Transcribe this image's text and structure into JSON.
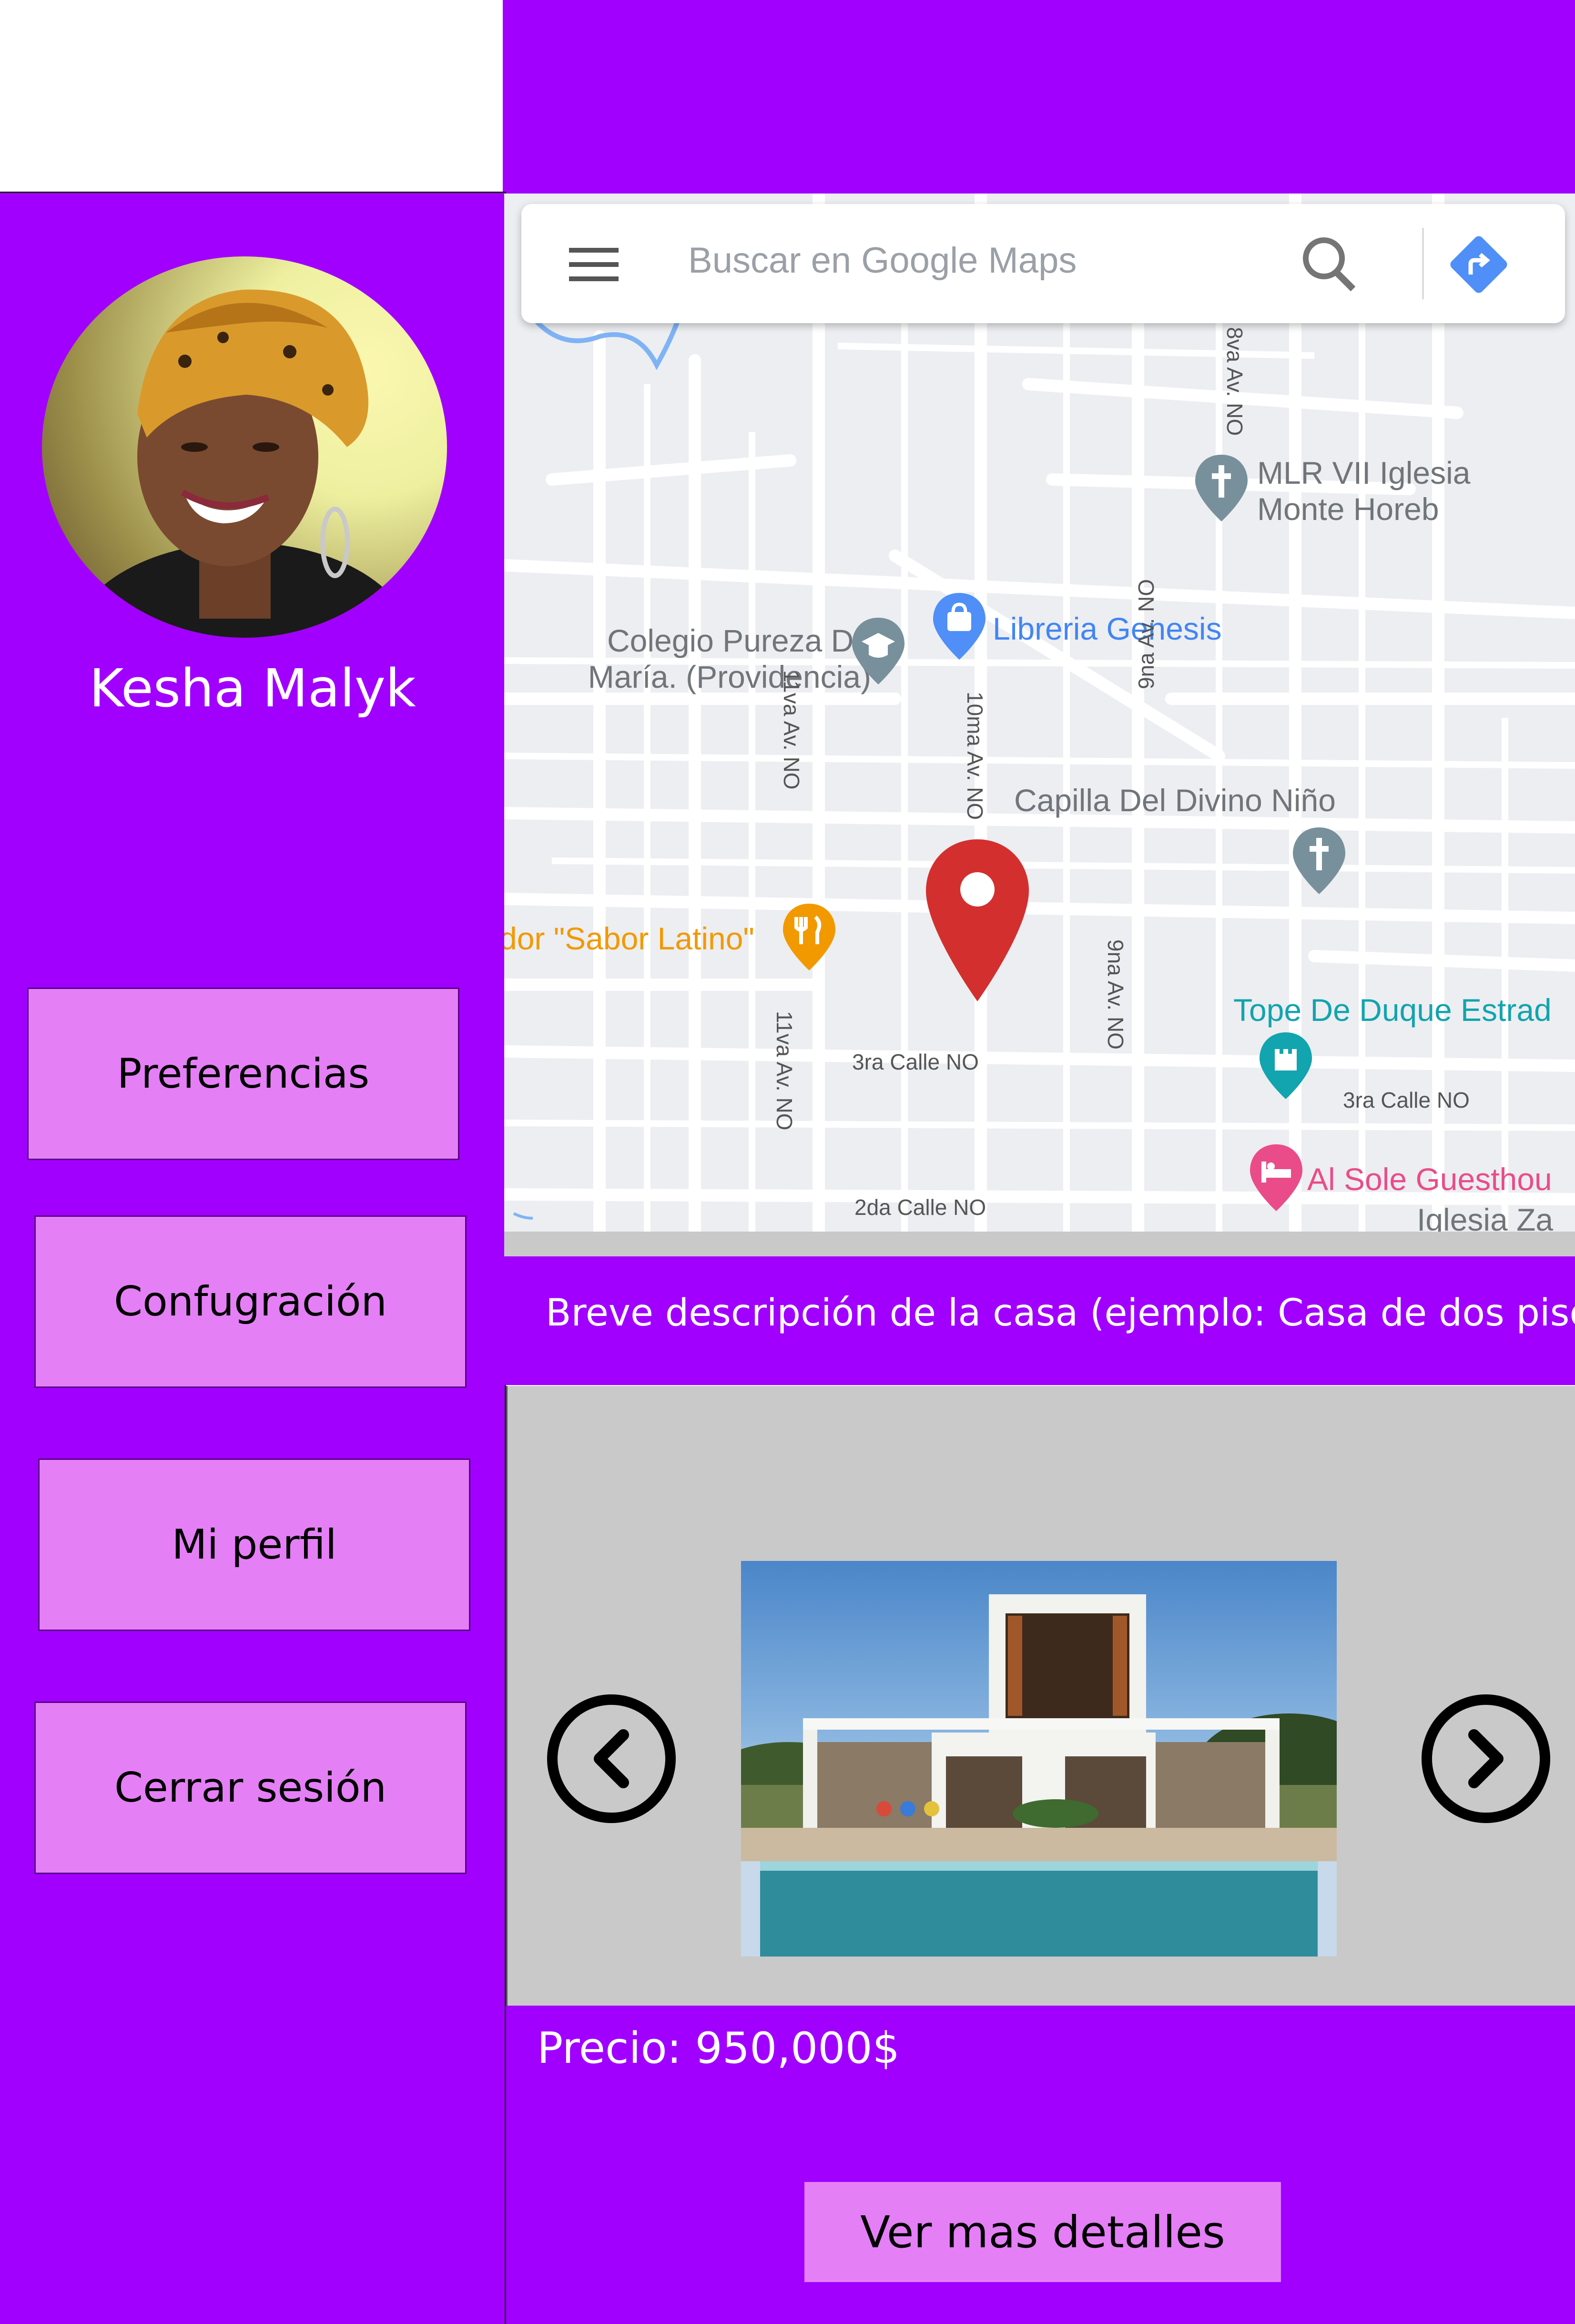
{
  "user": {
    "name": "Kesha Malyk"
  },
  "menu": {
    "items": [
      {
        "label": "Preferencias"
      },
      {
        "label": "Confugración"
      },
      {
        "label": "Mi perfil"
      },
      {
        "label": "Cerrar sesión"
      }
    ]
  },
  "map": {
    "search_placeholder": "Buscar en Google Maps",
    "places": {
      "iglesia_line1": "MLR VII Iglesia",
      "iglesia_line2": "Monte Horeb",
      "colegio_line1": "Colegio Pureza De",
      "colegio_line2": "María. (Providencia)",
      "libreria": "Libreria Genesis",
      "capilla": "Capilla Del Divino Niño",
      "sabor": "dor \"Sabor Latino\"",
      "tope": "Tope De Duque Estrad",
      "sole": "Al Sole Guesthou",
      "iglesia_za": "Iglesia Za"
    },
    "streets": {
      "s11va_top": "11va Av. NO",
      "s9na_top": "9na Av. NO",
      "s8va": "8va Av. NO",
      "s10ma": "10ma Av. NO",
      "s11va_bottom": "11va Av. NO",
      "s9na_bottom": "9na Av. NO",
      "s3ra_left": "3ra Calle NO",
      "s3ra_right": "3ra Calle NO",
      "s2da": "2da Calle NO"
    }
  },
  "listing": {
    "description": "Breve descripción de la casa (ejemplo: Casa de dos pisos)",
    "price": "Precio: 950,000$",
    "details_button": "Ver mas detalles"
  },
  "colors": {
    "primary": "#a100ff",
    "button": "#e57ff6",
    "gallery_bg": "#c9c9c9",
    "pin": "#d32f2f"
  }
}
